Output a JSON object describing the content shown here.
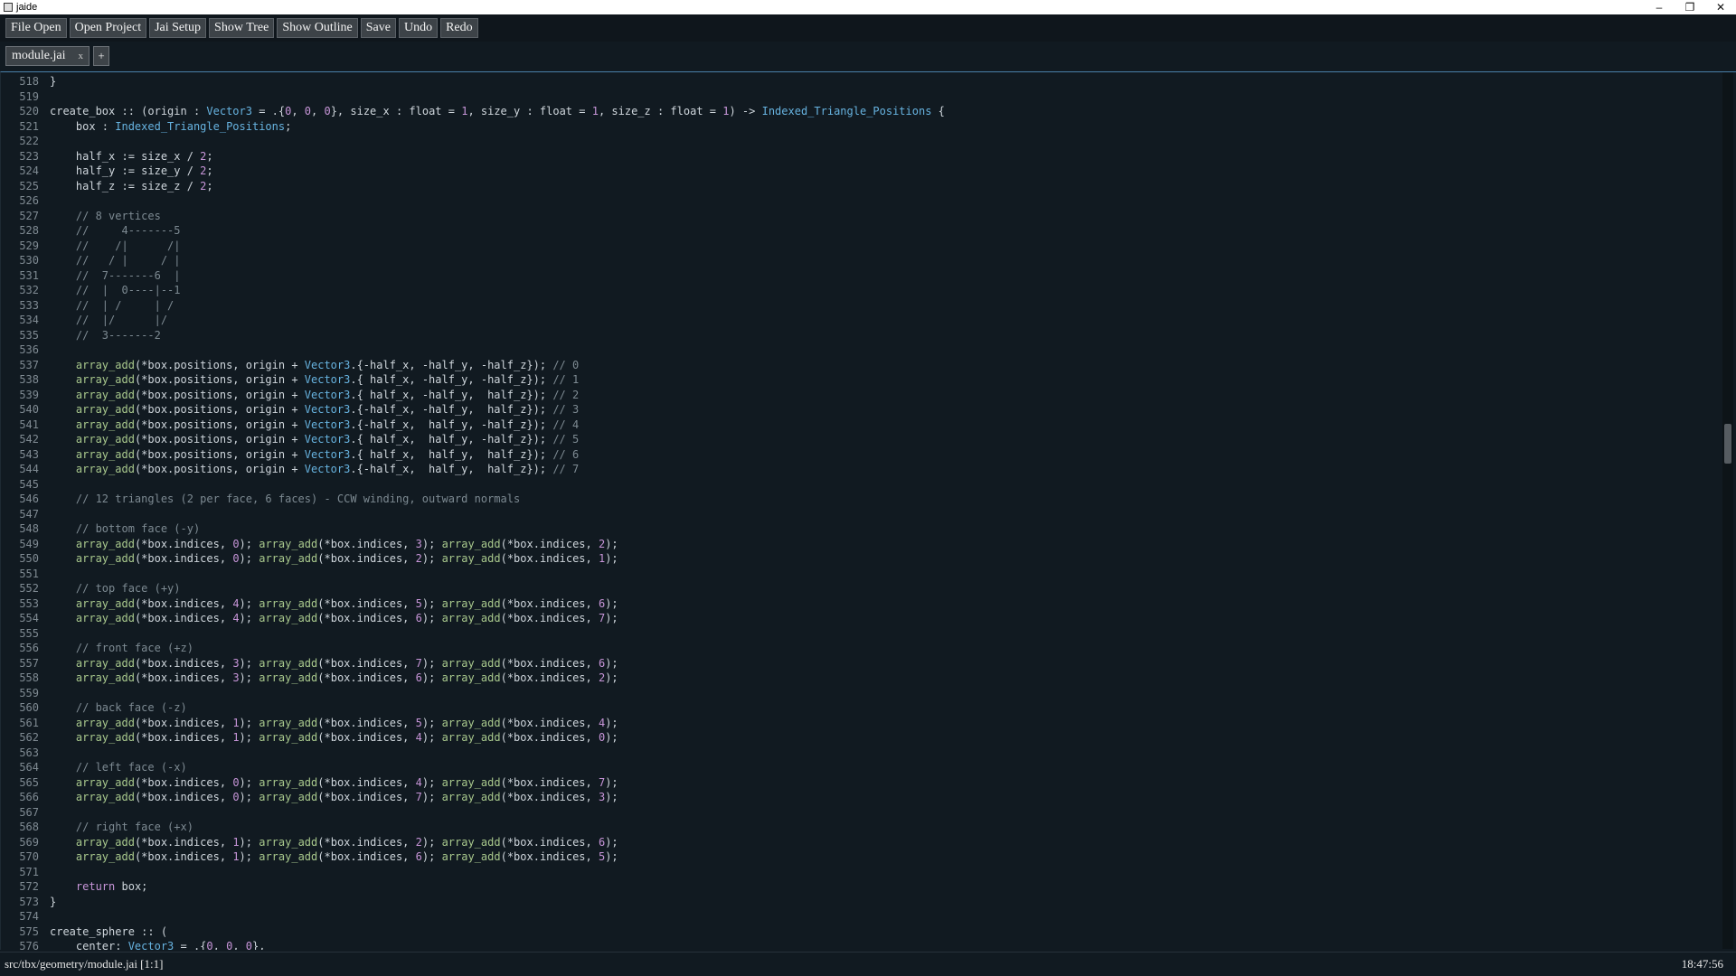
{
  "window": {
    "title": "jaide",
    "minimize": "–",
    "restore": "❐",
    "close": "✕"
  },
  "toolbar": {
    "buttons": [
      "File Open",
      "Open Project",
      "Jai Setup",
      "Show Tree",
      "Show Outline",
      "Save",
      "Undo",
      "Redo"
    ]
  },
  "tabs": [
    {
      "label": "module.jai",
      "close": "x"
    }
  ],
  "add_tab_label": "+",
  "editor": {
    "scroll_position": 0.42,
    "scroll_thumb_fraction": 0.045,
    "lines": [
      {
        "n": 518,
        "t": "}"
      },
      {
        "n": 519,
        "t": ""
      },
      {
        "n": 520,
        "t": "create_box :: (origin : Vector3 = .{0, 0, 0}, size_x : float = 1, size_y : float = 1, size_z : float = 1) -> Indexed_Triangle_Positions {"
      },
      {
        "n": 521,
        "t": "    box : Indexed_Triangle_Positions;"
      },
      {
        "n": 522,
        "t": ""
      },
      {
        "n": 523,
        "t": "    half_x := size_x / 2;"
      },
      {
        "n": 524,
        "t": "    half_y := size_y / 2;"
      },
      {
        "n": 525,
        "t": "    half_z := size_z / 2;"
      },
      {
        "n": 526,
        "t": ""
      },
      {
        "n": 527,
        "t": "    // 8 vertices"
      },
      {
        "n": 528,
        "t": "    //     4-------5"
      },
      {
        "n": 529,
        "t": "    //    /|      /|"
      },
      {
        "n": 530,
        "t": "    //   / |     / |"
      },
      {
        "n": 531,
        "t": "    //  7-------6  |"
      },
      {
        "n": 532,
        "t": "    //  |  0----|--1"
      },
      {
        "n": 533,
        "t": "    //  | /     | /"
      },
      {
        "n": 534,
        "t": "    //  |/      |/"
      },
      {
        "n": 535,
        "t": "    //  3-------2"
      },
      {
        "n": 536,
        "t": ""
      },
      {
        "n": 537,
        "t": "    array_add(*box.positions, origin + Vector3.{-half_x, -half_y, -half_z}); // 0"
      },
      {
        "n": 538,
        "t": "    array_add(*box.positions, origin + Vector3.{ half_x, -half_y, -half_z}); // 1"
      },
      {
        "n": 539,
        "t": "    array_add(*box.positions, origin + Vector3.{ half_x, -half_y,  half_z}); // 2"
      },
      {
        "n": 540,
        "t": "    array_add(*box.positions, origin + Vector3.{-half_x, -half_y,  half_z}); // 3"
      },
      {
        "n": 541,
        "t": "    array_add(*box.positions, origin + Vector3.{-half_x,  half_y, -half_z}); // 4"
      },
      {
        "n": 542,
        "t": "    array_add(*box.positions, origin + Vector3.{ half_x,  half_y, -half_z}); // 5"
      },
      {
        "n": 543,
        "t": "    array_add(*box.positions, origin + Vector3.{ half_x,  half_y,  half_z}); // 6"
      },
      {
        "n": 544,
        "t": "    array_add(*box.positions, origin + Vector3.{-half_x,  half_y,  half_z}); // 7"
      },
      {
        "n": 545,
        "t": ""
      },
      {
        "n": 546,
        "t": "    // 12 triangles (2 per face, 6 faces) - CCW winding, outward normals"
      },
      {
        "n": 547,
        "t": ""
      },
      {
        "n": 548,
        "t": "    // bottom face (-y)"
      },
      {
        "n": 549,
        "t": "    array_add(*box.indices, 0); array_add(*box.indices, 3); array_add(*box.indices, 2);"
      },
      {
        "n": 550,
        "t": "    array_add(*box.indices, 0); array_add(*box.indices, 2); array_add(*box.indices, 1);"
      },
      {
        "n": 551,
        "t": ""
      },
      {
        "n": 552,
        "t": "    // top face (+y)"
      },
      {
        "n": 553,
        "t": "    array_add(*box.indices, 4); array_add(*box.indices, 5); array_add(*box.indices, 6);"
      },
      {
        "n": 554,
        "t": "    array_add(*box.indices, 4); array_add(*box.indices, 6); array_add(*box.indices, 7);"
      },
      {
        "n": 555,
        "t": ""
      },
      {
        "n": 556,
        "t": "    // front face (+z)"
      },
      {
        "n": 557,
        "t": "    array_add(*box.indices, 3); array_add(*box.indices, 7); array_add(*box.indices, 6);"
      },
      {
        "n": 558,
        "t": "    array_add(*box.indices, 3); array_add(*box.indices, 6); array_add(*box.indices, 2);"
      },
      {
        "n": 559,
        "t": ""
      },
      {
        "n": 560,
        "t": "    // back face (-z)"
      },
      {
        "n": 561,
        "t": "    array_add(*box.indices, 1); array_add(*box.indices, 5); array_add(*box.indices, 4);"
      },
      {
        "n": 562,
        "t": "    array_add(*box.indices, 1); array_add(*box.indices, 4); array_add(*box.indices, 0);"
      },
      {
        "n": 563,
        "t": ""
      },
      {
        "n": 564,
        "t": "    // left face (-x)"
      },
      {
        "n": 565,
        "t": "    array_add(*box.indices, 0); array_add(*box.indices, 4); array_add(*box.indices, 7);"
      },
      {
        "n": 566,
        "t": "    array_add(*box.indices, 0); array_add(*box.indices, 7); array_add(*box.indices, 3);"
      },
      {
        "n": 567,
        "t": ""
      },
      {
        "n": 568,
        "t": "    // right face (+x)"
      },
      {
        "n": 569,
        "t": "    array_add(*box.indices, 1); array_add(*box.indices, 2); array_add(*box.indices, 6);"
      },
      {
        "n": 570,
        "t": "    array_add(*box.indices, 1); array_add(*box.indices, 6); array_add(*box.indices, 5);"
      },
      {
        "n": 571,
        "t": ""
      },
      {
        "n": 572,
        "t": "    return box;"
      },
      {
        "n": 573,
        "t": "}"
      },
      {
        "n": 574,
        "t": ""
      },
      {
        "n": 575,
        "t": "create_sphere :: ("
      },
      {
        "n": 576,
        "t": "    center: Vector3 = .{0, 0, 0},"
      }
    ]
  },
  "status": {
    "path": "src/tbx/geometry/module.jai  [1:1]",
    "clock": "18:47:56"
  },
  "colors": {
    "background": "#111a21",
    "function": "#a9c98d",
    "type": "#67b3e0",
    "number": "#c795d8",
    "comment": "#7d8a92",
    "accent_border": "#4a7fa8"
  }
}
